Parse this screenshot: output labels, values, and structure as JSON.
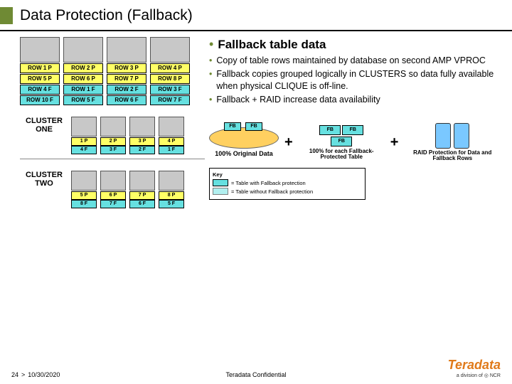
{
  "title": "Data Protection (Fallback)",
  "subheading": "Fallback table data",
  "bullets": [
    "Copy of table rows maintained by database on second AMP VPROC",
    "Fallback copies grouped logically in CLUSTERS so data fully available when physical CLIQUE is off-line.",
    "Fallback + RAID increase data availability"
  ],
  "amp_grid": [
    [
      {
        "t": "ROW 1 P",
        "c": "yellow"
      },
      {
        "t": "ROW 5 P",
        "c": "yellow"
      },
      {
        "t": "ROW 4 F",
        "c": "cyan"
      },
      {
        "t": "ROW 10 F",
        "c": "cyan"
      }
    ],
    [
      {
        "t": "ROW 2 P",
        "c": "yellow"
      },
      {
        "t": "ROW 6 P",
        "c": "yellow"
      },
      {
        "t": "ROW 1 F",
        "c": "cyan"
      },
      {
        "t": "ROW 5 F",
        "c": "cyan"
      }
    ],
    [
      {
        "t": "ROW 3 P",
        "c": "yellow"
      },
      {
        "t": "ROW 7 P",
        "c": "yellow"
      },
      {
        "t": "ROW 2 F",
        "c": "cyan"
      },
      {
        "t": "ROW 6 F",
        "c": "cyan"
      }
    ],
    [
      {
        "t": "ROW 4 P",
        "c": "yellow"
      },
      {
        "t": "ROW 8 P",
        "c": "yellow"
      },
      {
        "t": "ROW 3 F",
        "c": "cyan"
      },
      {
        "t": "ROW 7 F",
        "c": "cyan"
      }
    ]
  ],
  "clusters": [
    {
      "label_top": "CLUSTER",
      "label_bot": "ONE",
      "cols": [
        [
          {
            "t": "1 P",
            "c": "yellow"
          },
          {
            "t": "4 F",
            "c": "cyan"
          }
        ],
        [
          {
            "t": "2 P",
            "c": "yellow"
          },
          {
            "t": "3 F",
            "c": "cyan"
          }
        ],
        [
          {
            "t": "3 P",
            "c": "yellow"
          },
          {
            "t": "2 F",
            "c": "cyan"
          }
        ],
        [
          {
            "t": "4 P",
            "c": "yellow"
          },
          {
            "t": "1 F",
            "c": "cyan"
          }
        ]
      ]
    },
    {
      "label_top": "CLUSTER",
      "label_bot": "TWO",
      "cols": [
        [
          {
            "t": "5 P",
            "c": "yellow"
          },
          {
            "t": "8 F",
            "c": "cyan"
          }
        ],
        [
          {
            "t": "6 P",
            "c": "yellow"
          },
          {
            "t": "7 F",
            "c": "cyan"
          }
        ],
        [
          {
            "t": "7 P",
            "c": "yellow"
          },
          {
            "t": "6 F",
            "c": "cyan"
          }
        ],
        [
          {
            "t": "8 P",
            "c": "yellow"
          },
          {
            "t": "5 F",
            "c": "cyan"
          }
        ]
      ]
    }
  ],
  "diagram": {
    "original_label": "100% Original Data",
    "fb_tag": "FB",
    "fallback_caption": "100% for each Fallback-Protected Table",
    "raid_caption": "RAID Protection for Data and Fallback Rows",
    "plus": "+"
  },
  "key": {
    "title": "Key",
    "row1": "= Table with Fallback protection",
    "row2": "= Table without Fallback protection"
  },
  "footer": {
    "page": "24",
    "sep": ">",
    "date": "10/30/2020",
    "center": "Teradata Confidential",
    "brand": "Teradata",
    "brand_sub": "a division of ◎ NCR"
  }
}
